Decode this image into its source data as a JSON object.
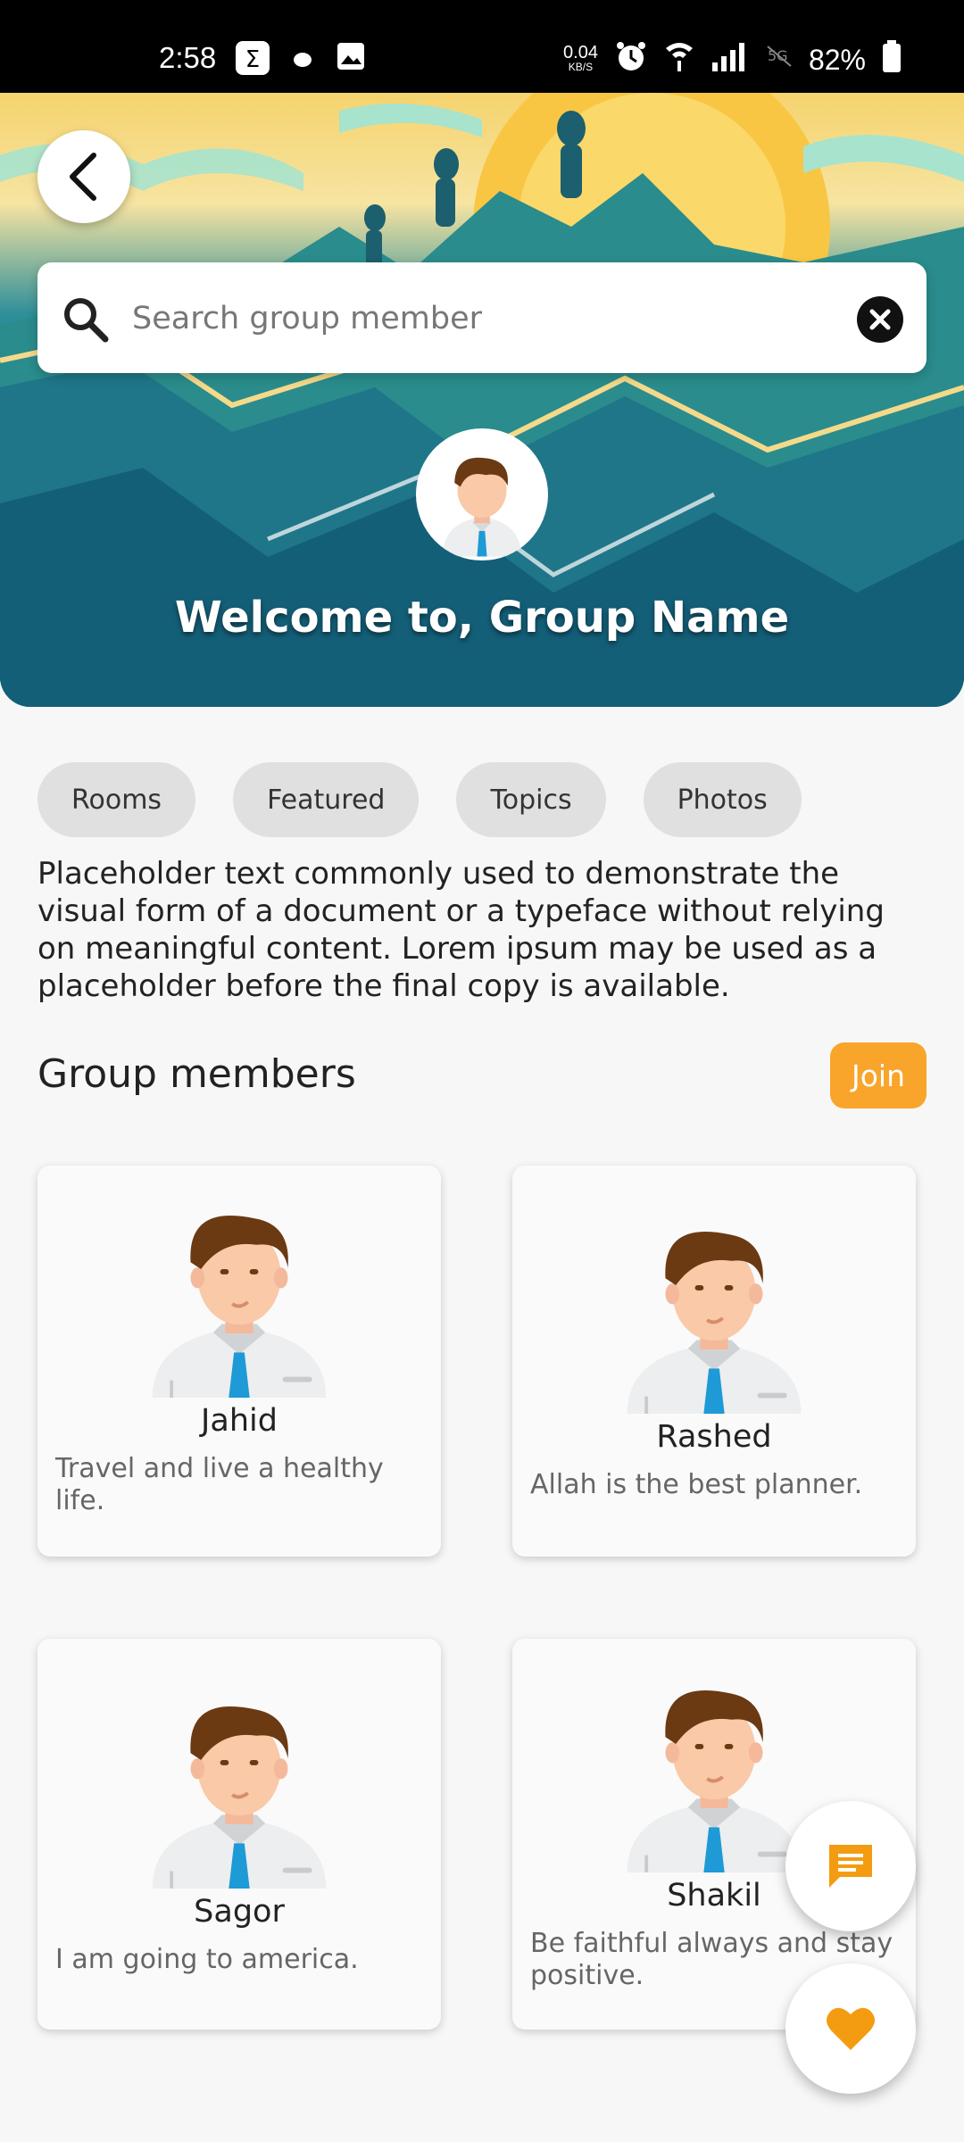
{
  "status_bar": {
    "time": "2:58",
    "speed": "0.04",
    "speed_unit": "KB/S",
    "battery": "82%"
  },
  "search": {
    "placeholder": "Search group member"
  },
  "hero": {
    "welcome": "Welcome to, Group Name"
  },
  "chips": [
    "Rooms",
    "Featured",
    "Topics",
    "Photos"
  ],
  "description": "Placeholder text commonly used to demonstrate the visual form of a document or a typeface without relying on meaningful content. Lorem ipsum may be used as a placeholder before the final copy is available.",
  "members_section": {
    "title": "Group members",
    "join_label": "Join"
  },
  "members": [
    {
      "name": "Jahid",
      "bio": "Travel and live a healthy life."
    },
    {
      "name": "Rashed",
      "bio": "Allah is the best planner."
    },
    {
      "name": "Sagor",
      "bio": "I am going to america."
    },
    {
      "name": "Shakil",
      "bio": "Be faithful always and stay positive."
    }
  ],
  "colors": {
    "accent": "#f9a52b",
    "chip_bg": "#e0e0e0",
    "tie": "#1e9ad6"
  }
}
